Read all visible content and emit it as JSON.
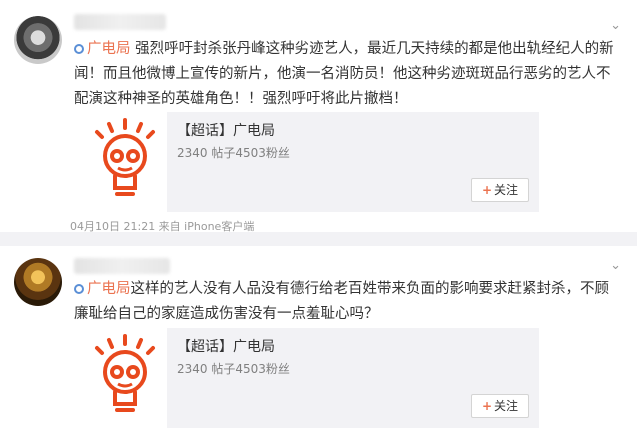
{
  "posts": [
    {
      "topic_tag": "广电局",
      "text": "强烈呼吁封杀张丹峰这种劣迹艺人，最近几天持续的都是他出轨经纪人的新闻！而且他微博上宣传的新片，他演一名消防员！他这种劣迹斑斑品行恶劣的艺人不配演这种神圣的英雄角色！！强烈呼吁将此片撤档！",
      "card": {
        "title": "【超话】广电局",
        "stats": "2340 帖子4503粉丝",
        "follow_label": "关注"
      },
      "meta": "04月10日 21:21 来自 iPhone客户端"
    },
    {
      "topic_tag": "广电局",
      "text": "这样的艺人没有人品没有德行给老百姓带来负面的影响要求赶紧封杀，不顾廉耻给自己的家庭造成伤害没有一点羞耻心吗？",
      "card": {
        "title": "【超话】广电局",
        "stats": "2340 帖子4503粉丝",
        "follow_label": "关注"
      }
    }
  ],
  "icons": {
    "chevron": "chevron-down-icon",
    "topic": "super-topic-icon",
    "logo": "lightbulb-logo-icon"
  },
  "colors": {
    "tag": "#eb7350",
    "logo": "#e8491d",
    "card_bg": "#f2f2f5"
  }
}
